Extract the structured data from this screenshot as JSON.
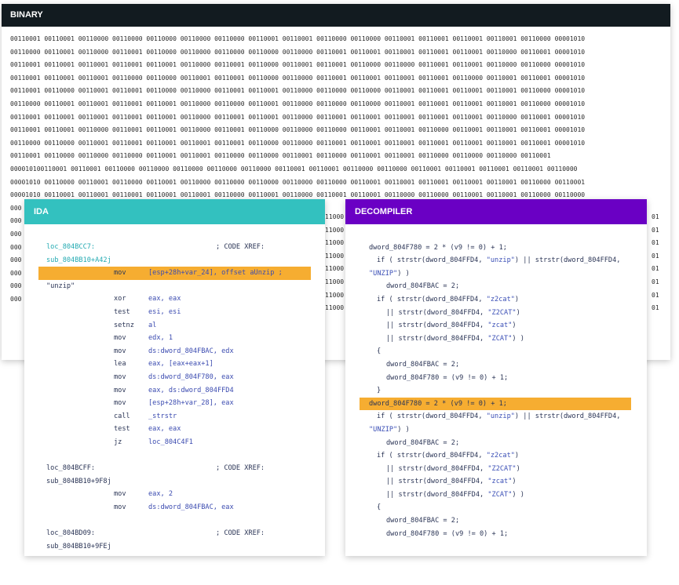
{
  "binary": {
    "title": "BINARY",
    "lines": [
      "00110001 00110001 00110000 00110000 00110000 00110000 00110000 00110001 00110001 00110000 00110000 00110001 00110001 00110001 00110001 00110000 00001010",
      "00110000 00110001 00110000 00110001 00110000 00110000 00110000 00110000 00110000 00110001 00110001 00110001 00110001 00110001 00110000 00110001 00001010",
      "00110001 00110001 00110001 00110001 00110001 00110000 00110001 00110000 00110001 00110001 00110000 00110000 00110001 00110001 00110000 00110000 00001010",
      "00110001 00110001 00110001 00110000 00110000 00110001 00110001 00110000 00110000 00110001 00110001 00110001 00110001 00110000 00110001 00110001 00001010",
      "00110001 00110000 00110001 00110001 00110000 00110000 00110001 00110001 00110000 00110000 00110000 00110001 00110001 00110001 00110001 00110000 00001010",
      "00110000 00110001 00110001 00110001 00110001 00110000 00110000 00110001 00110000 00110000 00110000 00110001 00110001 00110001 00110001 00110000 00001010",
      "00110001 00110001 00110001 00110001 00110001 00110000 00110001 00110001 00110000 00110001 00110001 00110001 00110001 00110001 00110000 00110001 00001010",
      "00110001 00110001 00110000 00110001 00110001 00110000 00110001 00110000 00110000 00110000 00110001 00110001 00110000 00110001 00110001 00110001 00001010",
      "00110000 00110000 00110001 00110001 00110001 00110001 00110001 00110000 00110000 00110001 00110001 00110001 00110001 00110001 00110001 00110001 00001010",
      "00110001 00110000 00110000 00110000 00110001 00110001 00110000 00110000 00110001 00110000 00110001 00110001 00110000 00110000 00110000 00110001",
      "000010100110001 00110001 00110000 00110000 00110000 00110000 00110000 00110001 00110001 00110000 00110000 00110001 00110001 00110001 00110001 00110000",
      "00001010 00110000 00110001 00110000 00110001 00110000 00110000 00110000 00110000 00110000 00110001 00110001 00110001 00110001 00110001 00110000 00110001",
      "00001010 00110001 00110001 00110001 00110001 00110001 00110000 00110001 00110000 00110001 00110001 00110000 00110000 00110001 00110001 00110000 00110000",
      "000",
      "000",
      "000",
      "000",
      "000",
      "000",
      "000",
      "000"
    ],
    "right_fragments": [
      "11000",
      "11000",
      "11000",
      "11000",
      "11000",
      "11000",
      "11000",
      "11000"
    ],
    "right_edge": [
      "01",
      "01",
      "01",
      "01",
      "01",
      "01",
      "01",
      "01"
    ]
  },
  "ida": {
    "title": "IDA",
    "lines": [
      {
        "a": "loc_804BCC7:",
        "b": "",
        "c": "; CODE XREF:",
        "type": "label"
      },
      {
        "a": "sub_804BB10+A42j",
        "b": "",
        "c": "",
        "type": "labelcont"
      },
      {
        "a": "mov",
        "b": "[esp+28h+var_24], offset aUnzip ;",
        "c": "",
        "type": "hl"
      },
      {
        "a": "\"unzip\"",
        "b": "",
        "c": "",
        "type": "str"
      },
      {
        "a": "xor",
        "b": "eax, eax",
        "c": "",
        "type": "ins"
      },
      {
        "a": "test",
        "b": "esi, esi",
        "c": "",
        "type": "ins"
      },
      {
        "a": "setnz",
        "b": "al",
        "c": "",
        "type": "ins"
      },
      {
        "a": "mov",
        "b": "edx, 1",
        "c": "",
        "type": "ins"
      },
      {
        "a": "mov",
        "b": "ds:dword_804FBAC, edx",
        "c": "",
        "type": "ins"
      },
      {
        "a": "lea",
        "b": "eax, [eax+eax+1]",
        "c": "",
        "type": "ins"
      },
      {
        "a": "mov",
        "b": "ds:dword_804F780, eax",
        "c": "",
        "type": "ins"
      },
      {
        "a": "mov",
        "b": "eax, ds:dword_804FFD4",
        "c": "",
        "type": "ins"
      },
      {
        "a": "mov",
        "b": "[esp+28h+var_28], eax",
        "c": "",
        "type": "ins"
      },
      {
        "a": "call",
        "b": "_strstr",
        "c": "",
        "type": "ins"
      },
      {
        "a": "test",
        "b": "eax, eax",
        "c": "",
        "type": "ins"
      },
      {
        "a": "jz",
        "b": "loc_804C4F1",
        "c": "",
        "type": "ins"
      },
      {
        "a": "",
        "b": "",
        "c": "",
        "type": "blank"
      },
      {
        "a": "loc_804BCFF:",
        "b": "",
        "c": "; CODE XREF:",
        "type": "label2"
      },
      {
        "a": "sub_804BB10+9F8j",
        "b": "",
        "c": "",
        "type": "labelcont2"
      },
      {
        "a": "mov",
        "b": "eax, 2",
        "c": "",
        "type": "ins"
      },
      {
        "a": "mov",
        "b": "ds:dword_804FBAC, eax",
        "c": "",
        "type": "ins"
      },
      {
        "a": "",
        "b": "",
        "c": "",
        "type": "blank"
      },
      {
        "a": "loc_804BD09:",
        "b": "",
        "c": "; CODE XREF:",
        "type": "label2"
      },
      {
        "a": "sub_804BB10+9FEj",
        "b": "",
        "c": "",
        "type": "labelcont2"
      }
    ]
  },
  "decompiler": {
    "title": "DECOMPILER",
    "lines": [
      {
        "t": "",
        "indent": 0,
        "hl": false
      },
      {
        "t": "dword_804F780 = 2 * (v9 != 0) + 1;",
        "indent": 1,
        "hl": false
      },
      {
        "t": "if ( strstr(dword_804FFD4, \"unzip\") || strstr(dword_804FFD4,",
        "indent": 2,
        "hl": false
      },
      {
        "t": "\"UNZIP\") )",
        "indent": 0,
        "hl": false
      },
      {
        "t": "dword_804FBAC = 2;",
        "indent": 3,
        "hl": false
      },
      {
        "t": "if ( strstr(dword_804FFD4, \"z2cat\")",
        "indent": 2,
        "hl": false
      },
      {
        "t": "|| strstr(dword_804FFD4, \"Z2CAT\")",
        "indent": 3,
        "hl": false
      },
      {
        "t": "|| strstr(dword_804FFD4, \"zcat\")",
        "indent": 3,
        "hl": false
      },
      {
        "t": "|| strstr(dword_804FFD4, \"ZCAT\") )",
        "indent": 3,
        "hl": false
      },
      {
        "t": "{",
        "indent": 2,
        "hl": false
      },
      {
        "t": "dword_804FBAC = 2;",
        "indent": 3,
        "hl": false
      },
      {
        "t": "dword_804F780 = (v9 != 0) + 1;",
        "indent": 3,
        "hl": false
      },
      {
        "t": "}",
        "indent": 2,
        "hl": false
      },
      {
        "t": "dword_804F780 = 2 * (v9 != 0) + 1;",
        "indent": 0,
        "hl": true
      },
      {
        "t": "if ( strstr(dword_804FFD4, \"unzip\") || strstr(dword_804FFD4,",
        "indent": 2,
        "hl": false
      },
      {
        "t": "\"UNZIP\") )",
        "indent": 0,
        "hl": false
      },
      {
        "t": "dword_804FBAC = 2;",
        "indent": 3,
        "hl": false
      },
      {
        "t": "if ( strstr(dword_804FFD4, \"z2cat\")",
        "indent": 2,
        "hl": false
      },
      {
        "t": "|| strstr(dword_804FFD4, \"Z2CAT\")",
        "indent": 3,
        "hl": false
      },
      {
        "t": "|| strstr(dword_804FFD4, \"zcat\")",
        "indent": 3,
        "hl": false
      },
      {
        "t": "|| strstr(dword_804FFD4, \"ZCAT\") )",
        "indent": 3,
        "hl": false
      },
      {
        "t": "{",
        "indent": 2,
        "hl": false
      },
      {
        "t": "dword_804FBAC = 2;",
        "indent": 3,
        "hl": false
      },
      {
        "t": "dword_804F780 = (v9 != 0) + 1;",
        "indent": 3,
        "hl": false
      }
    ]
  },
  "colors": {
    "binary_header": "#121b20",
    "ida_header": "#33c1bf",
    "decompiler_header": "#6a00c4",
    "highlight": "#f6ad31"
  }
}
